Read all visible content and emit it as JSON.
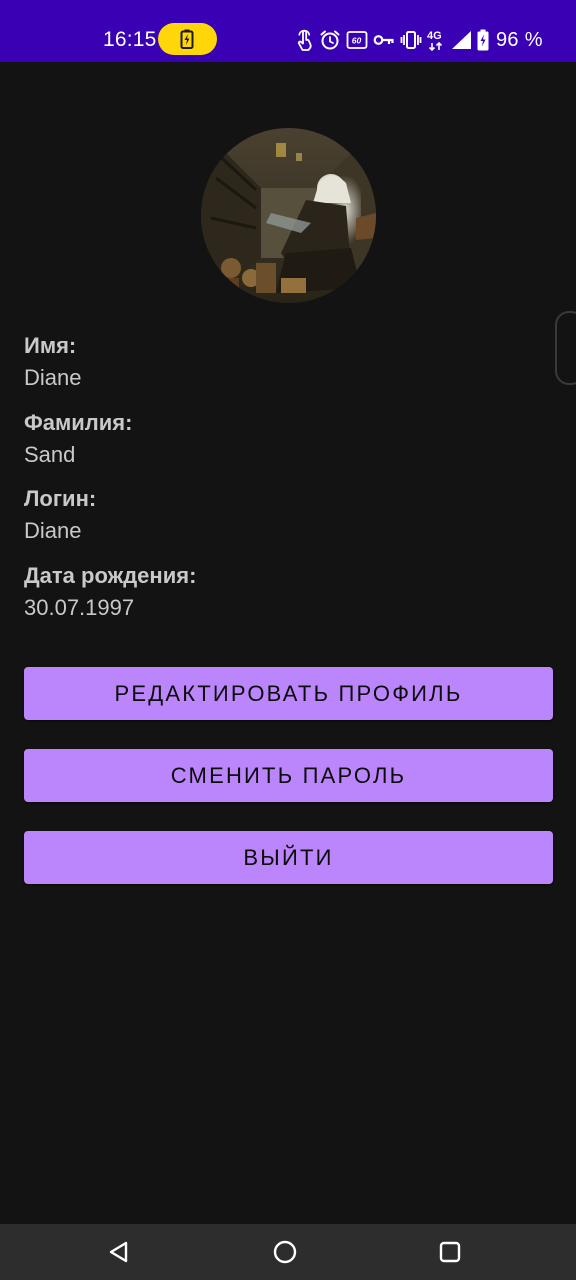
{
  "status_bar": {
    "time": "16:15",
    "battery_percent": "96 %",
    "icons": [
      "charging-battery-icon",
      "touch-gesture-icon",
      "alarm-icon",
      "hd-60-icon",
      "vpn-key-icon",
      "vibrate-icon",
      "network-4g-icon",
      "signal-icon",
      "battery-icon"
    ],
    "network_label": "4G",
    "bar_color": "#3a00b4",
    "pill_color": "#ffd60a"
  },
  "profile": {
    "fields": [
      {
        "label": "Имя:",
        "value": "Diane"
      },
      {
        "label": "Фамилия:",
        "value": "Sand"
      },
      {
        "label": "Логин:",
        "value": "Diane"
      },
      {
        "label": "Дата рождения:",
        "value": "30.07.1997"
      }
    ]
  },
  "actions": {
    "edit_profile": "РЕДАКТИРОВАТЬ ПРОФИЛЬ",
    "change_password": "СМЕНИТЬ ПАРОЛЬ",
    "logout": "ВЫЙТИ"
  },
  "navigation": {
    "icons": [
      "back-icon",
      "home-icon",
      "recents-icon"
    ]
  },
  "colors": {
    "background": "#131313",
    "accent": "#bb86fc",
    "text": "#c9c9c9",
    "nav_bar": "#2d2d2d"
  }
}
